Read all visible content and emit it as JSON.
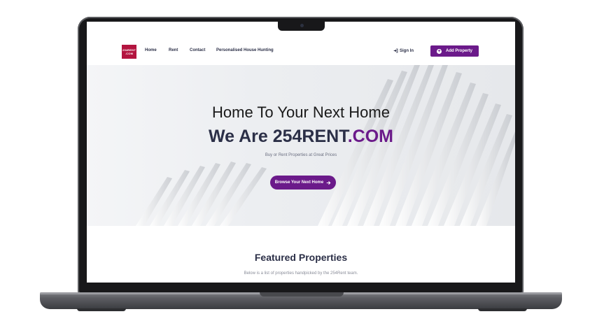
{
  "nav": {
    "logo_text_top": "254RENT",
    "logo_text_bottom": ".COM",
    "links": [
      "Home",
      "Rent",
      "Contact",
      "Personalised House Hunting"
    ],
    "signin_label": "Sign In",
    "add_property_label": "Add Property"
  },
  "hero": {
    "title_line1": "Home To Your Next Home",
    "title_line2_prefix": "We Are 254RENT",
    "title_line2_suffix": ".COM",
    "subtitle": "Buy or Rent Properties at Great Prices",
    "cta_label": "Browse Your Next Home"
  },
  "featured": {
    "title": "Featured Properties",
    "subtitle": "Below is a list of properties handpicked by the 254Rent team."
  },
  "colors": {
    "brand_purple": "#6b1a8a",
    "navy": "#2b2f47",
    "logo_red": "#b3143f"
  },
  "icons": [
    "sign-in-icon",
    "plus-circle-icon",
    "arrow-right-icon"
  ]
}
